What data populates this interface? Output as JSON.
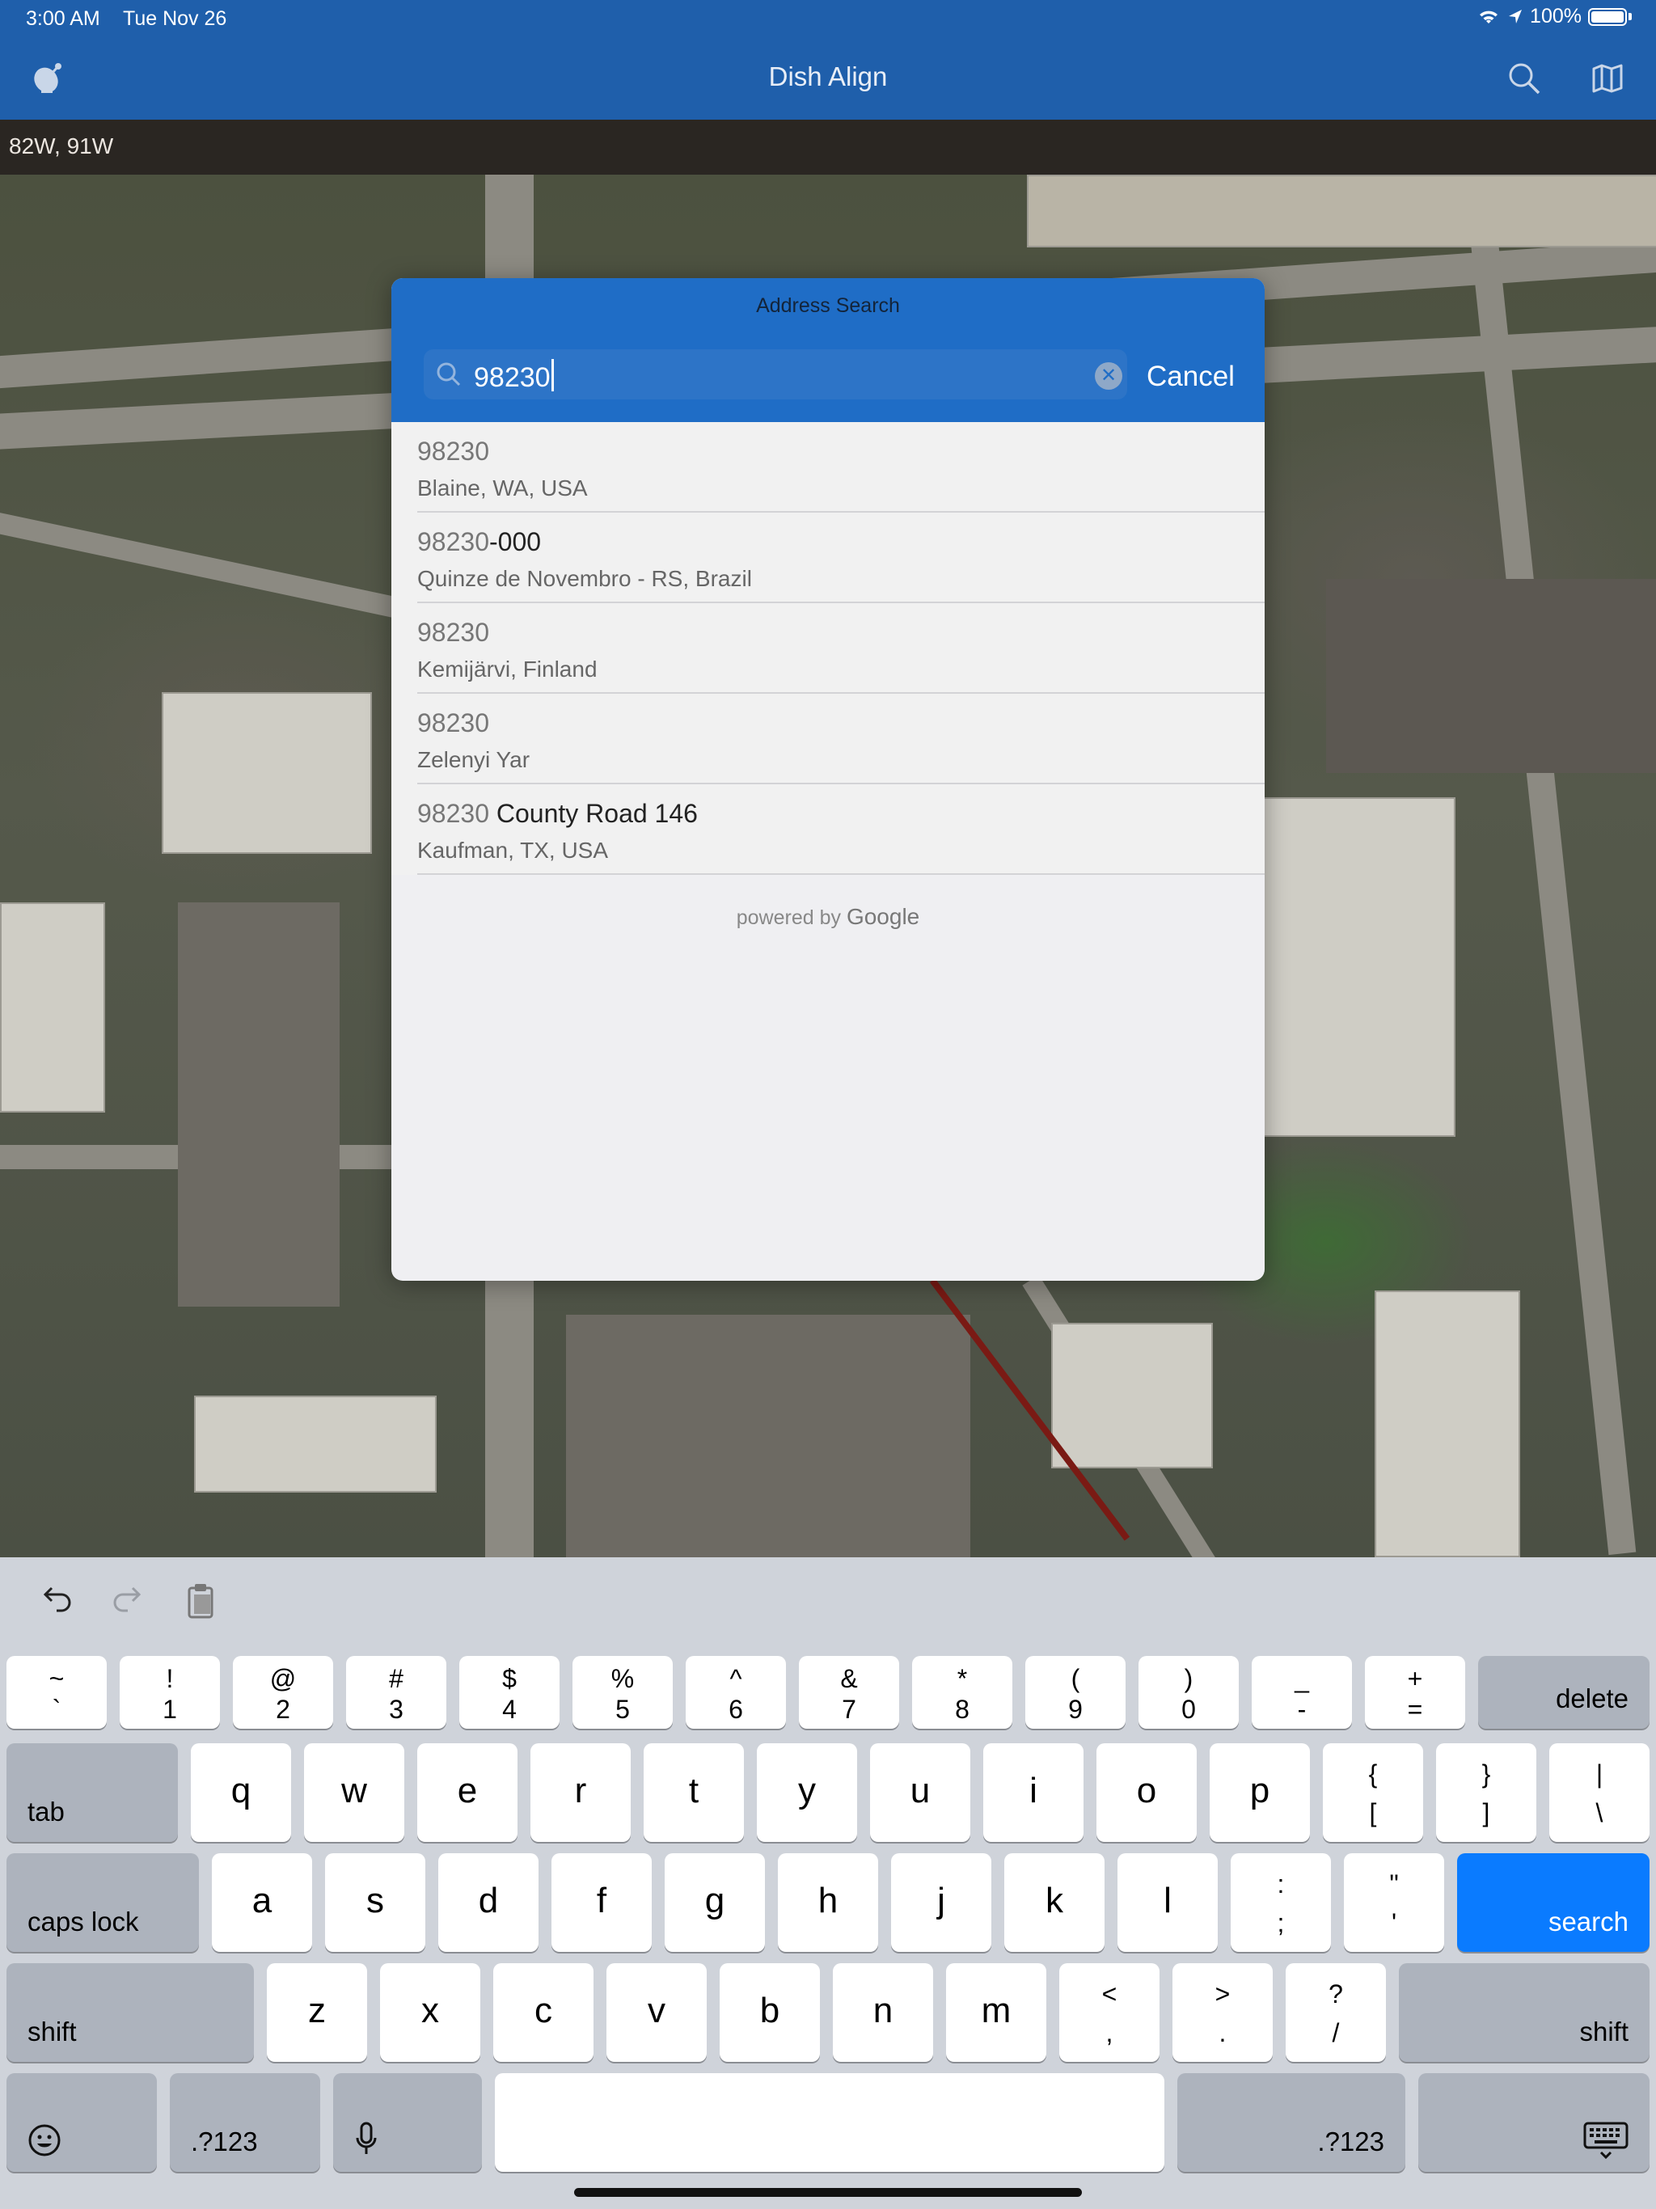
{
  "status_bar": {
    "time": "3:00 AM",
    "date": "Tue Nov 26",
    "battery": "100%"
  },
  "nav": {
    "title": "Dish Align",
    "left_icon": "satellite-dish-icon",
    "icons": [
      "search-icon",
      "map-icon"
    ]
  },
  "satellite_bar": {
    "text": "82W, 91W"
  },
  "modal": {
    "title": "Address Search",
    "search_value": "98230",
    "cancel_label": "Cancel",
    "results": [
      {
        "match": "98230",
        "rest": "",
        "subtitle": "Blaine, WA, USA"
      },
      {
        "match": "98230",
        "rest": "-000",
        "subtitle": "Quinze de Novembro - RS, Brazil"
      },
      {
        "match": "98230",
        "rest": "",
        "subtitle": "Kemijärvi, Finland"
      },
      {
        "match": "98230",
        "rest": "",
        "subtitle": "Zelenyi Yar"
      },
      {
        "match": "98230",
        "rest": " County Road 146",
        "subtitle": "Kaufman, TX, USA"
      }
    ],
    "powered_prefix": "powered by",
    "powered_brand": "Google"
  },
  "keyboard": {
    "toolbar_icons": [
      "undo-icon",
      "redo-icon",
      "paste-icon"
    ],
    "num_row": [
      {
        "t": "~",
        "b": "`"
      },
      {
        "t": "!",
        "b": "1"
      },
      {
        "t": "@",
        "b": "2"
      },
      {
        "t": "#",
        "b": "3"
      },
      {
        "t": "$",
        "b": "4"
      },
      {
        "t": "%",
        "b": "5"
      },
      {
        "t": "^",
        "b": "6"
      },
      {
        "t": "&",
        "b": "7"
      },
      {
        "t": "*",
        "b": "8"
      },
      {
        "t": "(",
        "b": "9"
      },
      {
        "t": ")",
        "b": "0"
      },
      {
        "t": "_",
        "b": "-"
      },
      {
        "t": "+",
        "b": "="
      }
    ],
    "delete": "delete",
    "tab": "tab",
    "row_q": [
      "q",
      "w",
      "e",
      "r",
      "t",
      "y",
      "u",
      "i",
      "o",
      "p"
    ],
    "row_q_sym": [
      {
        "t": "{",
        "b": "["
      },
      {
        "t": "}",
        "b": "]"
      },
      {
        "t": "|",
        "b": "\\"
      }
    ],
    "caps": "caps lock",
    "row_a": [
      "a",
      "s",
      "d",
      "f",
      "g",
      "h",
      "j",
      "k",
      "l"
    ],
    "row_a_sym": [
      {
        "t": ":",
        "b": ";"
      },
      {
        "t": "\"",
        "b": "'"
      }
    ],
    "search": "search",
    "shift": "shift",
    "row_z": [
      "z",
      "x",
      "c",
      "v",
      "b",
      "n",
      "m"
    ],
    "row_z_sym": [
      {
        "t": "<",
        "b": ","
      },
      {
        "t": ">",
        "b": "."
      },
      {
        "t": "?",
        "b": "/"
      }
    ],
    "num_label": ".?123",
    "colors": {
      "search_key": "#0a7bff",
      "header": "#1f6dc6",
      "nav": "#1f5fab"
    }
  }
}
